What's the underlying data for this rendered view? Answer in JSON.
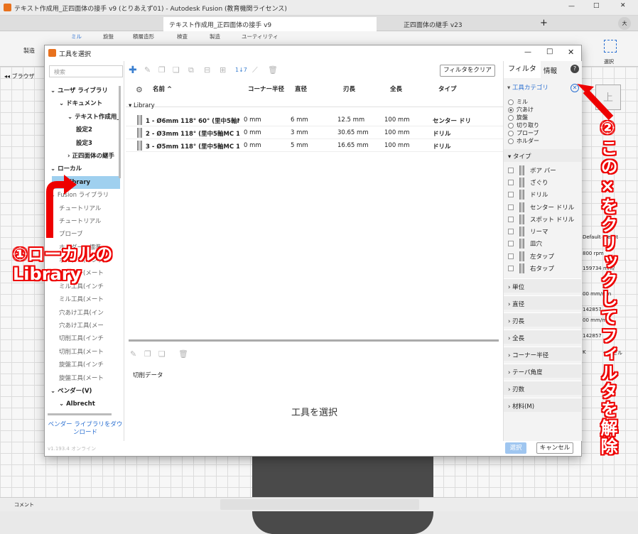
{
  "app": {
    "window_title": "テキスト作成用_正四面体の接手 v9 (とりあえず01) - Autodesk Fusion (教育機関ライセンス)",
    "doc_tabs": [
      "テキスト作成用_正四面体の接手 v9",
      "正四面体の継手 v23"
    ],
    "ribbon_tabs": [
      "ミル",
      "旋盤",
      "積層造形",
      "検査",
      "製造",
      "ユーティリティ"
    ],
    "ribbon_left": "製造",
    "browser_label": "ブラウザ",
    "right_labels": [
      "選択",
      "Default preset",
      "800 rpm",
      "159734 mm/",
      "00 mm/min",
      "142857",
      "00 mm/min",
      "142857",
      "K",
      "ャンセル"
    ],
    "comment_label": "コメント"
  },
  "dialog": {
    "title": "工具を選択",
    "search_placeholder": "検索",
    "tree": [
      {
        "label": "ユーザ ライブラリ",
        "indent": 0,
        "bold": true,
        "arrow": "v"
      },
      {
        "label": "ドキュメント",
        "indent": 1,
        "bold": true,
        "arrow": "v"
      },
      {
        "label": "テキスト作成用_",
        "indent": 2,
        "bold": true,
        "arrow": "v"
      },
      {
        "label": "設定2",
        "indent": 3,
        "bold": true,
        "arrow": ""
      },
      {
        "label": "設定3",
        "indent": 3,
        "bold": true,
        "arrow": ""
      },
      {
        "label": "正四面体の継手",
        "indent": 2,
        "bold": true,
        "arrow": ">"
      },
      {
        "label": "ローカル",
        "indent": 0,
        "bold": true,
        "arrow": "v"
      },
      {
        "label": "Library",
        "indent": 1,
        "bold": true,
        "arrow": "",
        "selected": true
      },
      {
        "label": "Fusion ライブラリ",
        "indent": 0,
        "bold": false,
        "arrow": "v"
      },
      {
        "label": "チュートリアル",
        "indent": 1,
        "bold": false,
        "arrow": ""
      },
      {
        "label": "チュートリアル",
        "indent": 1,
        "bold": false,
        "arrow": ""
      },
      {
        "label": "プローブ",
        "indent": 1,
        "bold": false,
        "arrow": ""
      },
      {
        "label": "ホルダー - 標準",
        "indent": 1,
        "bold": false,
        "arrow": ""
      },
      {
        "label": "ホルダー(インチ",
        "indent": 1,
        "bold": false,
        "arrow": ""
      },
      {
        "label": "ホルダー(メート",
        "indent": 1,
        "bold": false,
        "arrow": ""
      },
      {
        "label": "ミル工具(インチ",
        "indent": 1,
        "bold": false,
        "arrow": ""
      },
      {
        "label": "ミル工具(メート",
        "indent": 1,
        "bold": false,
        "arrow": ""
      },
      {
        "label": "穴あけ工具(イン",
        "indent": 1,
        "bold": false,
        "arrow": ""
      },
      {
        "label": "穴あけ工具(メー",
        "indent": 1,
        "bold": false,
        "arrow": ""
      },
      {
        "label": "切削工具(インチ",
        "indent": 1,
        "bold": false,
        "arrow": ""
      },
      {
        "label": "切削工具(メート",
        "indent": 1,
        "bold": false,
        "arrow": ""
      },
      {
        "label": "旋盤工具(インチ",
        "indent": 1,
        "bold": false,
        "arrow": ""
      },
      {
        "label": "旋盤工具(メート",
        "indent": 1,
        "bold": false,
        "arrow": ""
      },
      {
        "label": "ベンダー(V)",
        "indent": 0,
        "bold": true,
        "arrow": "v"
      },
      {
        "label": "Albrecht",
        "indent": 1,
        "bold": true,
        "arrow": "v"
      }
    ],
    "download_link": "ベンダー ライブラリをダウンロード",
    "version": "v1.193.4 オンライン",
    "filter_clear_button": "フィルタをクリア",
    "columns": [
      "名前 ^",
      "コーナー半径",
      "直径",
      "刃長",
      "全長",
      "タイプ"
    ],
    "group_label": "Library",
    "rows": [
      {
        "name": "1 - Ø6mm 118° 60° (里中5軸MC",
        "corner": "0 mm",
        "diameter": "6 mm",
        "flute": "12.5 mm",
        "overall": "100 mm",
        "type": "センター ドリ"
      },
      {
        "name": "2 - Ø3mm 118° (里中5軸MC 1",
        "corner": "0 mm",
        "diameter": "3 mm",
        "flute": "30.65 mm",
        "overall": "100 mm",
        "type": "ドリル"
      },
      {
        "name": "3 - Ø5mm 118° (里中5軸MC 1",
        "corner": "0 mm",
        "diameter": "5 mm",
        "flute": "16.65 mm",
        "overall": "100 mm",
        "type": "ドリル"
      }
    ],
    "cutting_data_label": "切削データ",
    "select_tool_text": "工具を選択",
    "right_tabs": [
      "フィルタ",
      "情報"
    ],
    "help_icon": "?",
    "tool_category_label": "工具カテゴリ",
    "categories": [
      {
        "label": "ミル",
        "checked": false
      },
      {
        "label": "穴あけ",
        "checked": true
      },
      {
        "label": "旋盤",
        "checked": false
      },
      {
        "label": "切り取り",
        "checked": false
      },
      {
        "label": "プローブ",
        "checked": false
      },
      {
        "label": "ホルダー",
        "checked": false
      }
    ],
    "type_label": "タイプ",
    "types": [
      "ボア バー",
      "ざぐり",
      "ドリル",
      "センター ドリル",
      "スポット ドリル",
      "リーマ",
      "皿穴",
      "左タップ",
      "右タップ"
    ],
    "filter_sections": [
      "単位",
      "直径",
      "刃長",
      "全長",
      "コーナー半径",
      "テーパ角度",
      "刃数",
      "材料(M)"
    ],
    "select_button": "選択",
    "cancel_button": "キャンセル"
  },
  "annotations": {
    "note1_line1": "①ローカルの",
    "note1_line2": "Library",
    "note2": "②この×をクリックしてフィルタを解除"
  },
  "colors": {
    "accent": "#2a6fd1",
    "selected_row": "#9fd0ef",
    "annotation": "#e00000"
  }
}
